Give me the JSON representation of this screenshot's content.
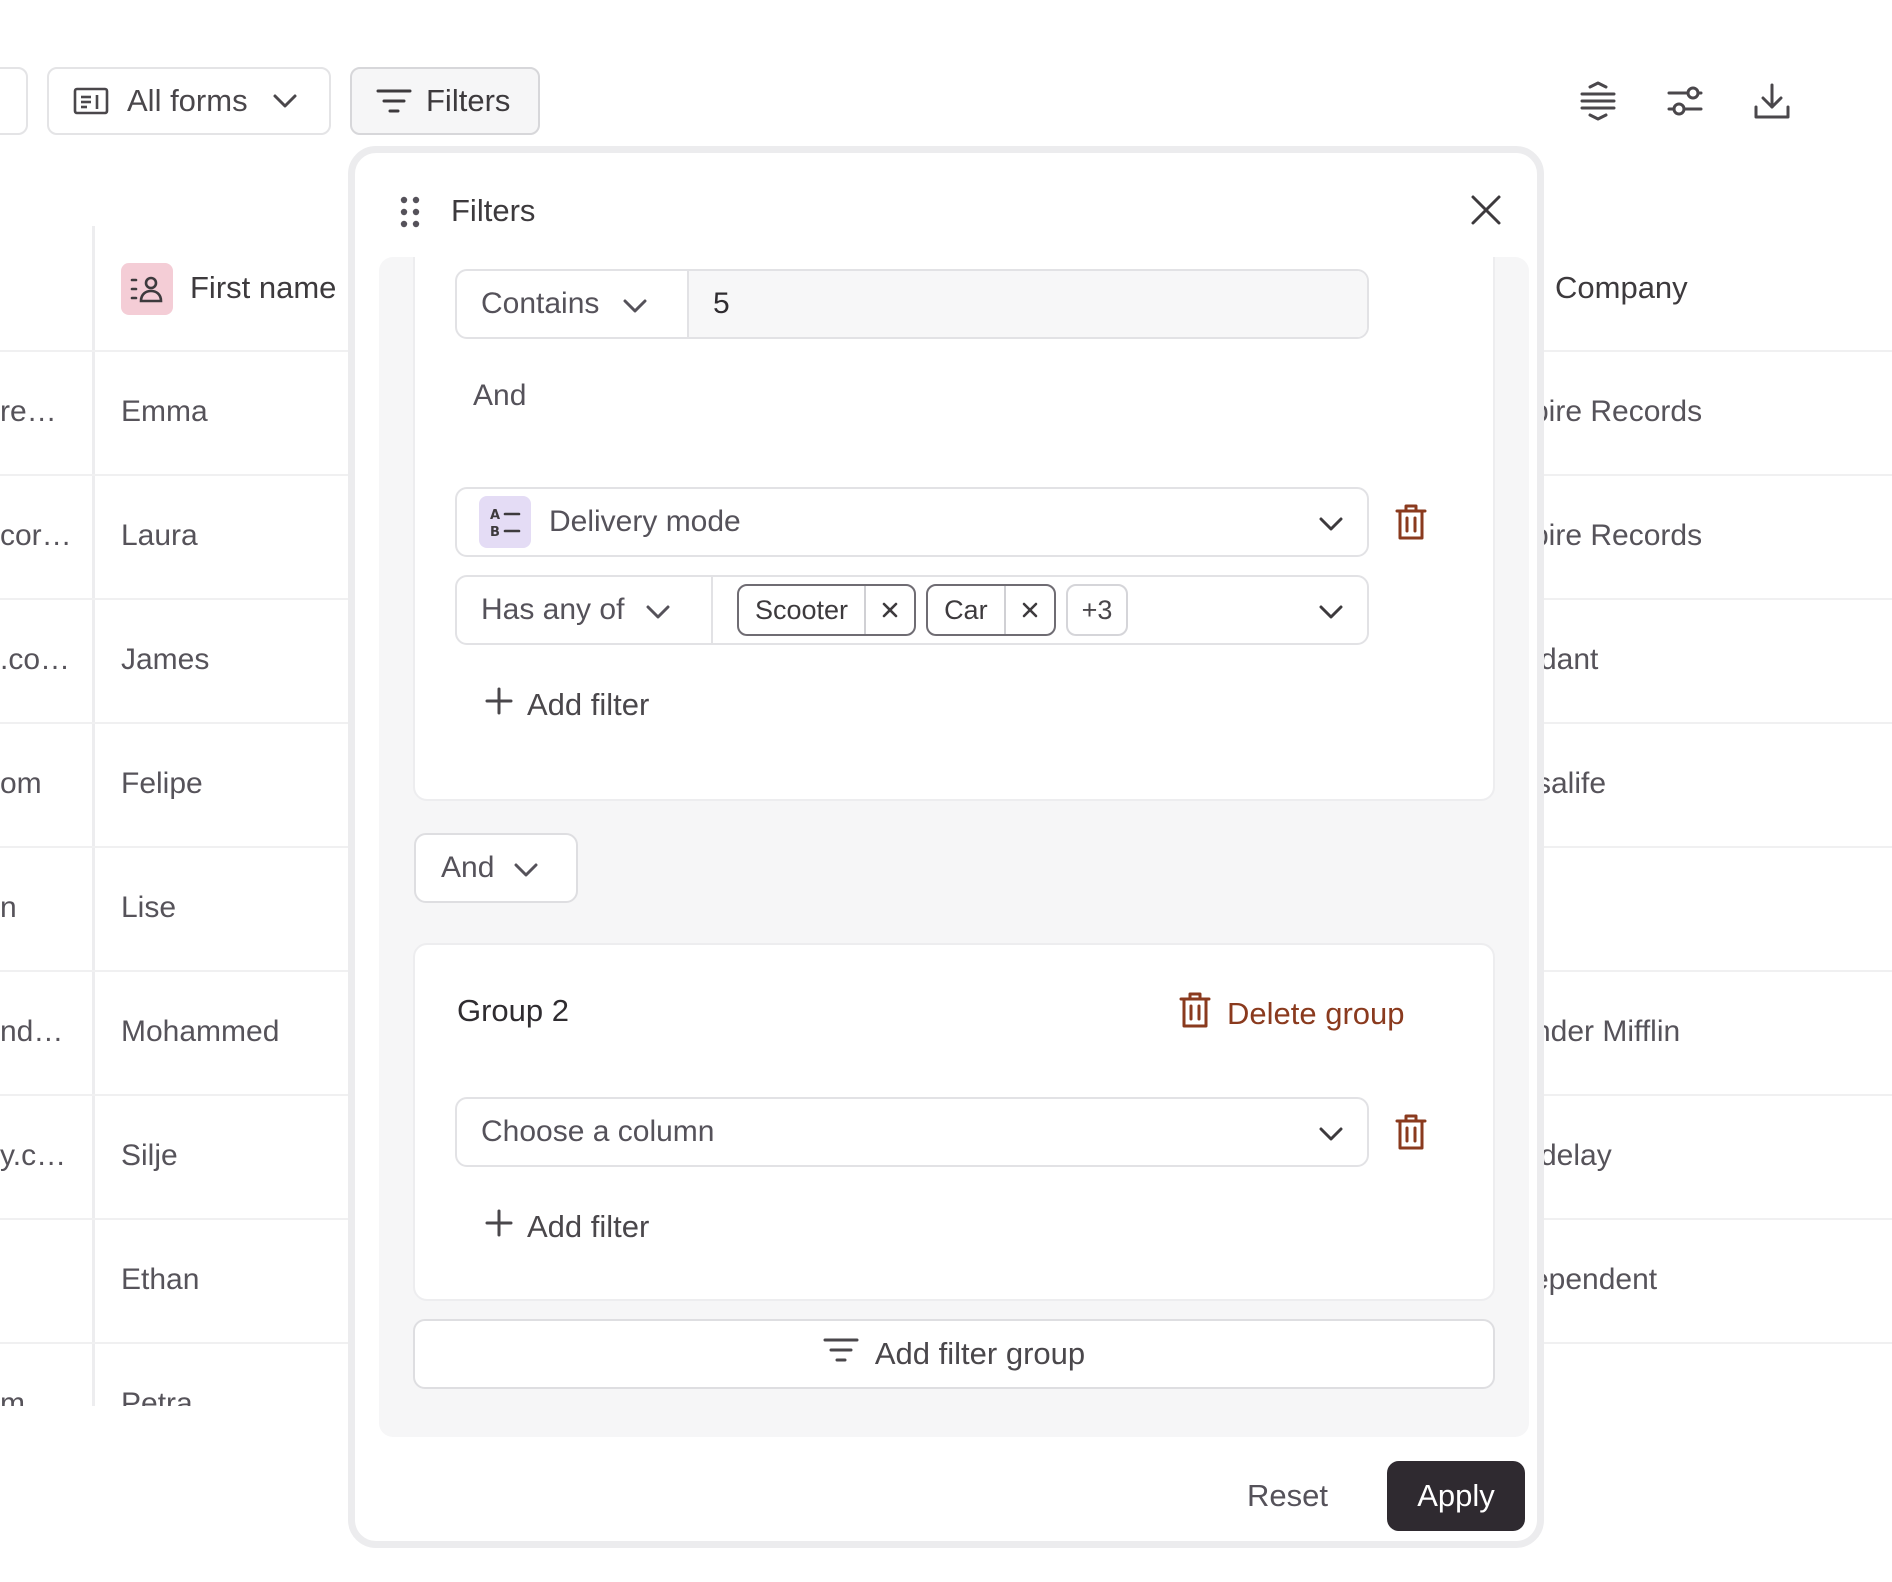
{
  "toolbar": {
    "forms_label": "All forms",
    "filters_label": "Filters"
  },
  "table": {
    "headers": {
      "first_name": "First name",
      "company": "Company"
    },
    "rows": [
      {
        "left": "re…",
        "first_name": "Emma",
        "company": "pire Records"
      },
      {
        "left": "cor…",
        "first_name": "Laura",
        "company": "pire Records"
      },
      {
        "left": ".co…",
        "first_name": "James",
        "company": "dant"
      },
      {
        "left": "om",
        "first_name": "Felipe",
        "company": "salife"
      },
      {
        "left": "n",
        "first_name": "Lise",
        "company": ""
      },
      {
        "left": "nd…",
        "first_name": "Mohammed",
        "company": "nder Mifflin"
      },
      {
        "left": "y.c…",
        "first_name": "Silje",
        "company": "delay"
      },
      {
        "left": "",
        "first_name": "Ethan",
        "company": "ependent"
      },
      {
        "left": "m",
        "first_name": "Petra",
        "company": ""
      }
    ]
  },
  "filters_popup": {
    "title": "Filters",
    "group1": {
      "condition1": {
        "operator": "Contains",
        "value": "5"
      },
      "joiner": "And",
      "condition2": {
        "column": "Delivery mode",
        "operator": "Has any of",
        "tags": [
          "Scooter",
          "Car"
        ],
        "more": "+3"
      },
      "add_filter_label": "Add filter"
    },
    "group_joiner": "And",
    "group2": {
      "title": "Group 2",
      "delete_label": "Delete group",
      "column_placeholder": "Choose a column",
      "add_filter_label": "Add filter"
    },
    "add_group_label": "Add filter group",
    "reset_label": "Reset",
    "apply_label": "Apply"
  },
  "colors": {
    "accent_dark": "#2f2a30",
    "danger": "#8a3a1e",
    "header_icon_bg": "#f4cdd6",
    "column_icon_bg": "#e4dcf5"
  }
}
